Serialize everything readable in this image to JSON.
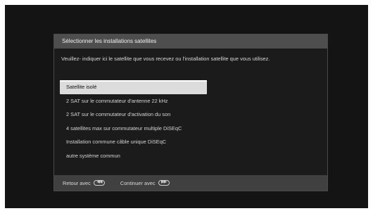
{
  "dialog": {
    "title": "Sélectionner les installations satellites",
    "description": "Veuillez- indiquer ici le satellite que vous recevez ou l'installation satellite que vous utilisez."
  },
  "options": [
    {
      "label": "Satellite isolé",
      "selected": true
    },
    {
      "label": "2 SAT sur le commutateur d'antenne 22 kHz",
      "selected": false
    },
    {
      "label": "2 SAT sur le commutateur d'activation du son",
      "selected": false
    },
    {
      "label": "4 satellites max sur commutateur multiple DiSEqC",
      "selected": false
    },
    {
      "label": "Installation commune câble unique DiSEqC",
      "selected": false
    },
    {
      "label": "autre système commun",
      "selected": false
    }
  ],
  "footer": {
    "back_label": "Retour avec",
    "back_icon": "rewind-key-icon",
    "continue_label": "Continuer avec",
    "continue_icon": "fast-forward-key-icon"
  },
  "colors": {
    "background": "#141414",
    "header": "#4e4e4e",
    "footer": "#404040",
    "selection": "#dcdcdc"
  }
}
